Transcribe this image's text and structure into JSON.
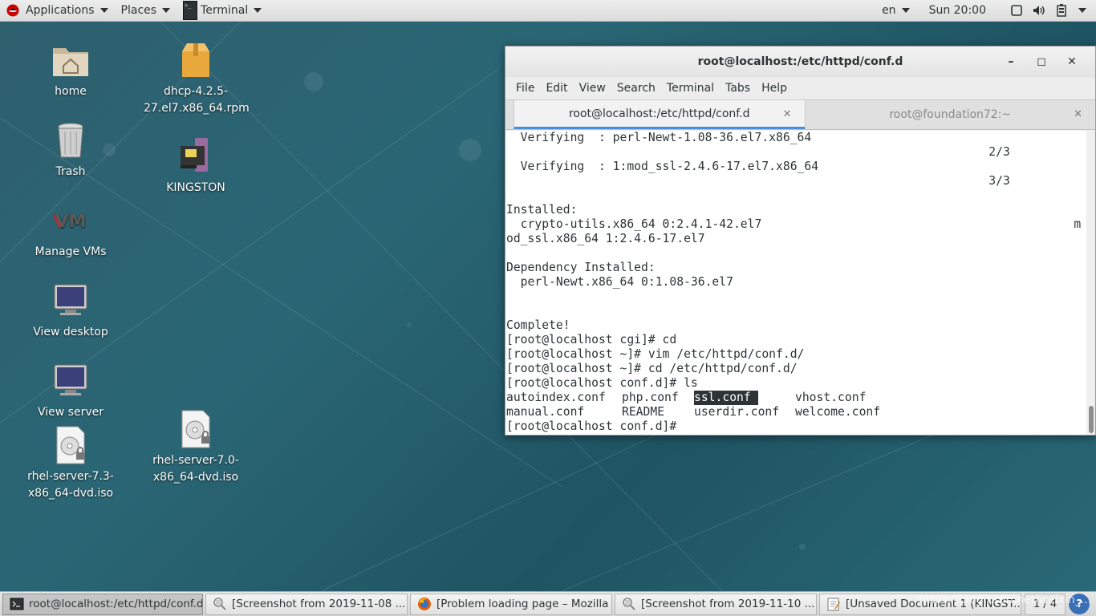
{
  "top_panel": {
    "applications": "Applications",
    "places": "Places",
    "terminal": "Terminal",
    "language": "en",
    "clock": "Sun 20:00"
  },
  "desktop_icons": [
    {
      "label": "home",
      "icon": "home-folder-icon"
    },
    {
      "label": "Trash",
      "icon": "trash-icon"
    },
    {
      "label": "Manage VMs",
      "icon": "virt-manager-icon"
    },
    {
      "label": "View desktop",
      "icon": "monitor-icon"
    },
    {
      "label": "View server",
      "icon": "monitor-icon"
    },
    {
      "label": "rhel-server-7.3-x86_64-dvd.iso",
      "icon": "disc-image-icon"
    },
    {
      "label": "dhcp-4.2.5-27.el7.x86_64.rpm",
      "icon": "package-icon"
    },
    {
      "label": "KINGSTON",
      "icon": "usb-drive-icon"
    },
    {
      "label": "rhel-server-7.0-x86_64-dvd.iso",
      "icon": "disc-image-icon"
    }
  ],
  "terminal_window": {
    "title": "root@localhost:/etc/httpd/conf.d",
    "menu": [
      "File",
      "Edit",
      "View",
      "Search",
      "Terminal",
      "Tabs",
      "Help"
    ],
    "tabs": [
      {
        "label": "root@localhost:/etc/httpd/conf.d",
        "active": true
      },
      {
        "label": "root@foundation72:~",
        "active": false
      }
    ],
    "lines": [
      "  Verifying  : perl-Newt-1.08-36.el7.x86_64",
      "                                                                    2/3",
      "  Verifying  : 1:mod_ssl-2.4.6-17.el7.x86_64",
      "                                                                    3/3",
      "",
      "Installed:",
      "  crypto-utils.x86_64 0:2.4.1-42.el7                                            m",
      "od_ssl.x86_64 1:2.4.6-17.el7",
      "",
      "Dependency Installed:",
      "  perl-Newt.x86_64 0:1.08-36.el7",
      "",
      "",
      "Complete!",
      "[root@localhost cgi]# cd",
      "[root@localhost ~]# vim /etc/httpd/conf.d/",
      "[root@localhost ~]# cd /etc/httpd/conf.d/",
      "[root@localhost conf.d]# ls"
    ],
    "ls_output": {
      "row1": [
        "autoindex.conf",
        "php.conf",
        "ssl.conf",
        "vhost.conf"
      ],
      "row2": [
        "manual.conf",
        "README",
        "userdir.conf",
        "welcome.conf"
      ]
    },
    "prompt": "[root@localhost conf.d]#"
  },
  "taskbar": {
    "items": [
      {
        "label": "root@localhost:/etc/httpd/conf.d",
        "icon": "terminal-icon",
        "active": true
      },
      {
        "label": "[Screenshot from 2019-11-08 ...",
        "icon": "image-viewer-icon",
        "active": false
      },
      {
        "label": "[Problem loading page – Mozilla ...",
        "icon": "firefox-icon",
        "active": false
      },
      {
        "label": "[Screenshot from 2019-11-10 ...",
        "icon": "image-viewer-icon",
        "active": false
      },
      {
        "label": "[Unsaved Document 1 (KINGST...",
        "icon": "text-editor-icon",
        "active": false
      }
    ],
    "workspace": "1 / 4"
  },
  "watermark": "https://blog.csdn.net/weixin_..."
}
